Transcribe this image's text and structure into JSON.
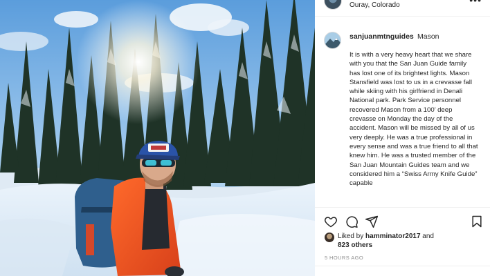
{
  "post_header": {
    "location": "Ouray, Colorado",
    "more_icon": "more-horizontal-icon"
  },
  "caption": {
    "username": "sanjuanmtnguides",
    "name": "Mason",
    "text": "It is with a very heavy heart that we share with you that the San Juan Guide family has lost one of its brightest lights. Mason Stansfield was lost to us in a crevasse fall while skiing with his girlfriend in Denali National park. Park Service personnel recovered Mason from a 100’ deep crevasse on Monday the day of the accident. Mason will be missed by all of us very deeply. He was a true professional in every sense and was a true friend to all that knew him. He was a trusted member of the San Juan Mountain Guides team and we considered him a “Swiss Army Knife Guide” capable"
  },
  "actions": {
    "like_icon": "heart-icon",
    "comment_icon": "comment-icon",
    "share_icon": "send-icon",
    "save_icon": "bookmark-icon"
  },
  "likes": {
    "prefix": "Liked by ",
    "liker": "hamminator2017",
    "connector": " and",
    "others": "823 others"
  },
  "timestamp": "5 HOURS AGO"
}
